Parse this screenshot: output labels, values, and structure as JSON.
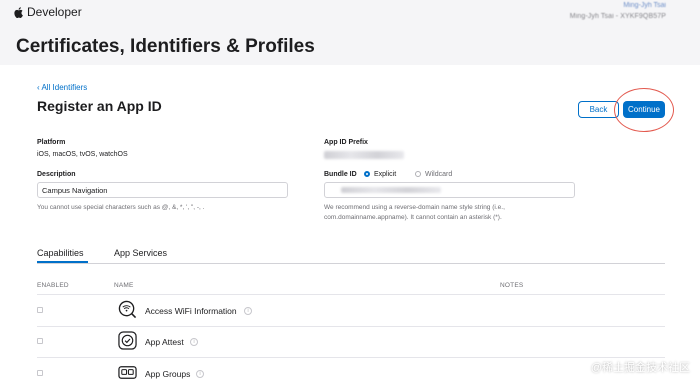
{
  "header": {
    "brand": "Developer",
    "user_name": "Ming-Jyh Tsai",
    "user_team": "Ming-Jyh Tsai - XYKF9QB57P"
  },
  "page": {
    "title": "Certificates, Identifiers & Profiles"
  },
  "breadcrumb": {
    "back_label": "‹ All Identifiers"
  },
  "form": {
    "title": "Register an App ID",
    "back_button": "Back",
    "continue_button": "Continue",
    "platform": {
      "label": "Platform",
      "value": "iOS, macOS, tvOS, watchOS"
    },
    "description": {
      "label": "Description",
      "value": "Campus Navigation",
      "hint": "You cannot use special characters such as @, &, *, ', \", -, ."
    },
    "app_id_prefix": {
      "label": "App ID Prefix"
    },
    "bundle_id": {
      "label": "Bundle ID",
      "options": [
        "Explicit",
        "Wildcard"
      ],
      "selected": "Explicit",
      "hint_line1": "We recommend using a reverse-domain name style string (i.e.,",
      "hint_line2": "com.domainname.appname). It cannot contain an asterisk (*)."
    }
  },
  "tabs": {
    "capabilities": "Capabilities",
    "app_services": "App Services",
    "active": "Capabilities"
  },
  "table": {
    "columns": {
      "enabled": "ENABLED",
      "name": "NAME",
      "notes": "NOTES"
    },
    "rows": [
      {
        "icon": "wifi-info-icon",
        "name": "Access WiFi Information",
        "enabled": false
      },
      {
        "icon": "app-attest-icon",
        "name": "App Attest",
        "enabled": false
      },
      {
        "icon": "app-groups-icon",
        "name": "App Groups",
        "enabled": false
      }
    ]
  },
  "watermark": "@稀土掘金技术社区",
  "colors": {
    "accent": "#0070c9",
    "highlight": "#e35a4f",
    "topbar": "#f5f5f7"
  }
}
